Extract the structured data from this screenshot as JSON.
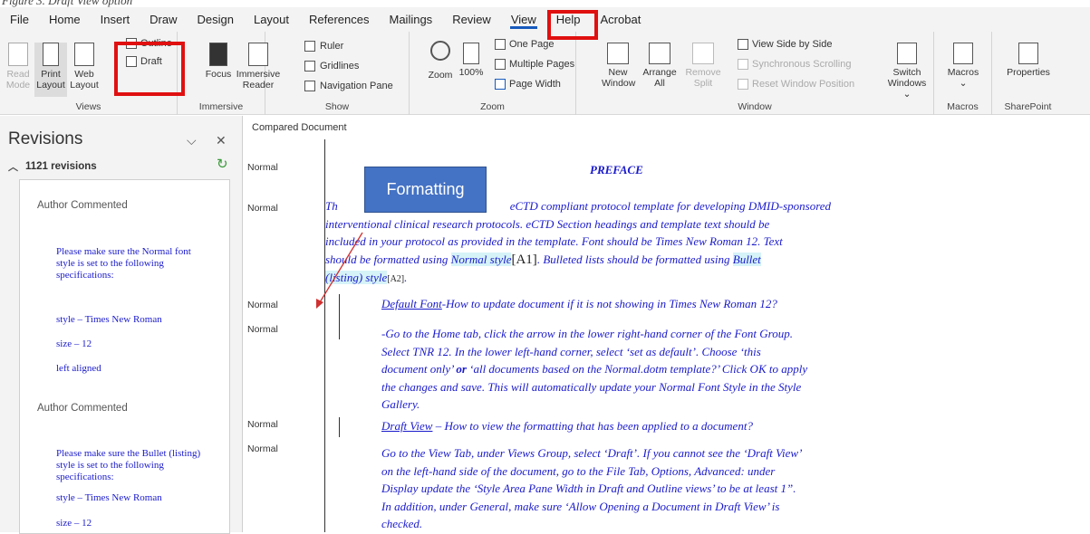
{
  "caption": "Figure 3. Draft View option",
  "menu": {
    "tabs": [
      "File",
      "Home",
      "Insert",
      "Draw",
      "Design",
      "Layout",
      "References",
      "Mailings",
      "Review",
      "View",
      "Help",
      "Acrobat"
    ],
    "active_tab": "View"
  },
  "ribbon": {
    "views": {
      "label": "Views",
      "read_mode": [
        "Read",
        "Mode"
      ],
      "print_layout": [
        "Print",
        "Layout"
      ],
      "web_layout": [
        "Web",
        "Layout"
      ],
      "outline": "Outline",
      "draft": "Draft"
    },
    "immersive": {
      "label": "Immersive",
      "focus": "Focus",
      "immersive_reader": [
        "Immersive",
        "Reader"
      ]
    },
    "show": {
      "label": "Show",
      "ruler": "Ruler",
      "gridlines": "Gridlines",
      "navigation_pane": "Navigation Pane"
    },
    "zoom": {
      "label": "Zoom",
      "zoom": "Zoom",
      "hundred": "100%",
      "one_page": "One Page",
      "multiple_pages": "Multiple Pages",
      "page_width": "Page Width"
    },
    "window": {
      "label": "Window",
      "new_window": [
        "New",
        "Window"
      ],
      "arrange_all": [
        "Arrange",
        "All"
      ],
      "remove_split": [
        "Remove",
        "Split"
      ],
      "view_side_by_side": "View Side by Side",
      "synchronous_scrolling": "Synchronous Scrolling",
      "reset_window_position": "Reset Window Position",
      "switch_windows": [
        "Switch",
        "Windows ⌄"
      ]
    },
    "macros": {
      "label": "Macros",
      "button": "Macros",
      "caret": "⌄"
    },
    "sharepoint": {
      "label": "SharePoint",
      "properties": "Properties"
    }
  },
  "revisions": {
    "title": "Revisions",
    "count": "1121 revisions",
    "items": [
      {
        "author": "Author Commented",
        "lines": [
          "Please make sure the Normal font style is set to the following specifications:",
          "style – Times New Roman",
          "size – 12",
          "left aligned"
        ]
      },
      {
        "author": "Author Commented",
        "lines": [
          "Please make sure the Bullet (listing) style is set to the following specifications:",
          "style – Times New Roman",
          "size – 12"
        ]
      }
    ]
  },
  "document": {
    "title": "Compared Document",
    "style_label": "Normal",
    "heading": "PREFACE",
    "callout": "Formatting",
    "p1": {
      "lead": "Th",
      "rest1": "eCTD compliant protocol template for developing DMID-sponsored",
      "line2": "interventional clinical research protocols. eCTD Section headings and template text should be",
      "line3": "included in your protocol as provided in the template. Font should be Times New Roman 12.  Text",
      "line4_a": "should be formatted using ",
      "line4_hl1": "Normal style",
      "line4_ann1": "[A1]",
      "line4_b": ". Bulleted lists should be formatted using ",
      "line4_hl2": "Bullet",
      "line5_hl": "(listing) style",
      "line5_ann2": "[A2]",
      "line5_end": "."
    },
    "p2": {
      "link": "Default Font",
      "rest": "-How to update document if it is not showing in Times New Roman 12?"
    },
    "p3": [
      "-Go to the Home tab, click the arrow in the lower right-hand corner of the Font Group.",
      "Select TNR 12.  In the lower left-hand corner, select ‘set as default’.  Choose ‘this",
      "the changes and save.  This will automatically update your Normal Font Style in the Style",
      "Gallery."
    ],
    "p3_line3": {
      "a": "document only’ ",
      "or": "or",
      "b": " ‘all documents based on the Normal.dotm template?’ Click OK to apply"
    },
    "p4": {
      "link": "Draft View",
      "rest": " – How to view the formatting that has been applied to a document?"
    },
    "p5": [
      "Go to the View Tab, under Views Group, select ‘Draft’.  If you cannot see the ‘Draft View’",
      "on the left-hand side of the document, go to the File Tab, Options, Advanced: under",
      "Display update the ‘Style Area Pane Width in Draft and Outline views’ to be at least 1”.",
      "In addition, under General, make sure ‘Allow Opening a Document in Draft View’ is",
      "checked."
    ]
  },
  "colors": {
    "accent": "#185abd",
    "redbox": "#e01010",
    "doc_text": "#1a1acc",
    "callout": "#4472c4",
    "highlight": "#d6f3f8"
  }
}
